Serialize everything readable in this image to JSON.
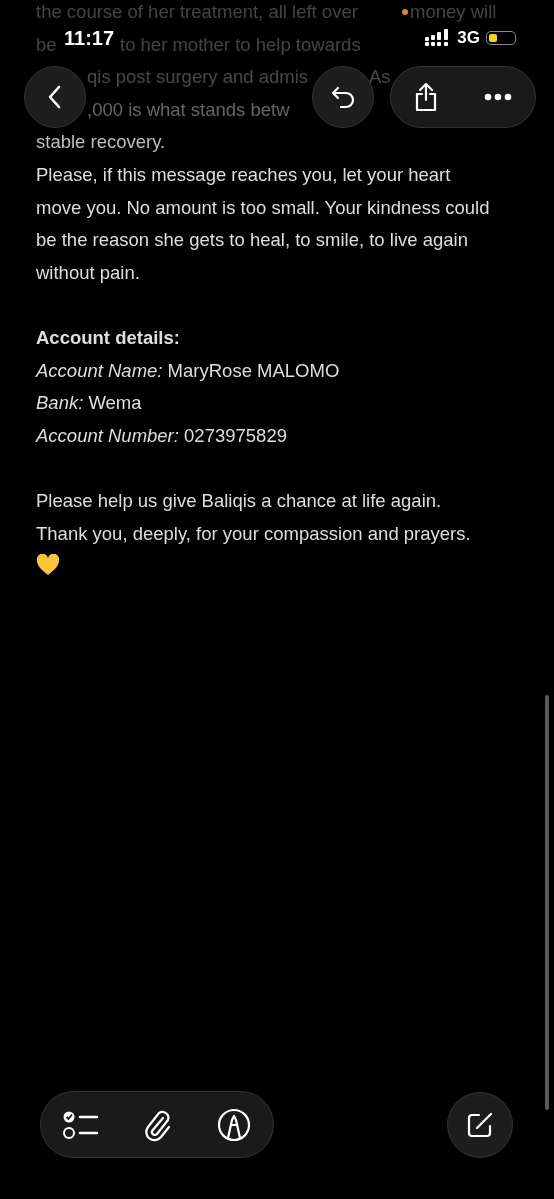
{
  "status_bar": {
    "time": "11:17",
    "network": "3G",
    "battery": {
      "level": 0.35
    }
  },
  "scrolled_lines": [
    [
      "the course of her treatment, all left over",
      "money will"
    ],
    [
      "be",
      "to her mother to help towards"
    ],
    [
      "qis post surgery and admis",
      "As"
    ],
    [
      ",000 is what stands betw"
    ]
  ],
  "note": {
    "lead_line": "stable recovery.",
    "paragraph": "Please, if this message reaches you, let your heart move you. No amount is too small. Your kindness could be the reason she gets to heal, to smile, to live again without pain.",
    "heading": "Account details:",
    "fields": [
      "*Account Name:* MaryRose MALOMO",
      "*Bank:* Wema",
      "*Account Number:* 0273975829"
    ],
    "closing": "Please help us give Baliqis a chance at life again. Thank you, deeply, for your compassion and prayers."
  }
}
